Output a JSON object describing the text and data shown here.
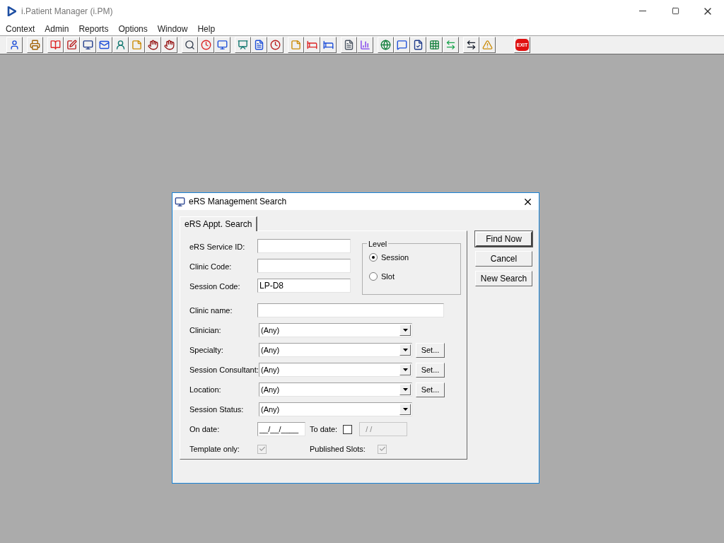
{
  "app": {
    "title": "i.Patient Manager (i.PM)"
  },
  "menu": [
    "Context",
    "Admin",
    "Reports",
    "Options",
    "Window",
    "Help"
  ],
  "toolbar": {
    "exit_label": "EXIT"
  },
  "dialog": {
    "title": "eRS Management Search",
    "tabs": [
      {
        "label": "eRS Appt. Search",
        "selected": true
      }
    ],
    "text_fields": [
      {
        "label": "eRS Service ID:"
      },
      {
        "label": "Clinic Code:"
      },
      {
        "label": "Session Code:",
        "value": "LP-D8"
      }
    ],
    "level": {
      "label": "Level",
      "options": [
        {
          "label": "Session",
          "selected": true
        },
        {
          "label": "Slot",
          "selected": false
        }
      ]
    },
    "clinic_name": {
      "label": "Clinic name:"
    },
    "dropdowns": [
      {
        "label": "Clinician:",
        "value": "(Any)"
      },
      {
        "label": "Specialty:",
        "value": "(Any)",
        "set_button": "Set..."
      },
      {
        "label": "Session Consultant:",
        "value": "(Any)",
        "set_button": "Set..."
      },
      {
        "label": "Location:",
        "value": "(Any)",
        "set_button": "Set..."
      },
      {
        "label": "Session Status:",
        "value": "(Any)"
      }
    ],
    "on_date": {
      "label": "On date:",
      "value": "__/__/____"
    },
    "to_date": {
      "label": "To date:",
      "checked": false,
      "value": "/ /",
      "disabled": true
    },
    "flags": [
      {
        "label": "Template only:",
        "checked": true,
        "disabled": true
      },
      {
        "label": "Published Slots:",
        "checked": true,
        "disabled": true
      }
    ],
    "buttons": [
      {
        "label": "Find Now",
        "default": true
      },
      {
        "label": "Cancel",
        "default": false
      },
      {
        "label": "New Search",
        "default": false
      }
    ]
  }
}
